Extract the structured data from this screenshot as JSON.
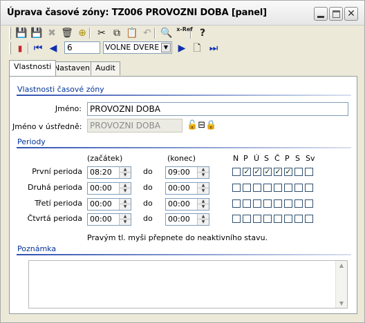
{
  "window": {
    "title": "Úprava časové zóny: TZ006 PROVOZNI DOBA [panel]",
    "minimize_label": "_",
    "close_label": "✕"
  },
  "toolbar": {
    "buttons": [
      {
        "icon": "save-icon",
        "glyph": "💾",
        "enabled": false
      },
      {
        "icon": "save-close-icon",
        "glyph": "💾",
        "enabled": true
      },
      {
        "icon": "delete-icon",
        "glyph": "✖",
        "enabled": false
      },
      {
        "icon": "trash-icon",
        "glyph": "🗑",
        "enabled": true
      },
      {
        "icon": "up-icon",
        "glyph": "⊕",
        "enabled": true
      },
      {
        "icon": "cut-icon",
        "glyph": "✂",
        "enabled": true
      },
      {
        "icon": "copy-icon",
        "glyph": "⧉",
        "enabled": true
      },
      {
        "icon": "paste-icon",
        "glyph": "📋",
        "enabled": false
      },
      {
        "icon": "undo-icon",
        "glyph": "↶",
        "enabled": false
      },
      {
        "icon": "binoculars-icon",
        "glyph": "🔍",
        "enabled": true
      },
      {
        "icon": "ref-icon",
        "glyph": "x-Ref",
        "enabled": true
      },
      {
        "icon": "help-icon",
        "glyph": "?",
        "enabled": true
      }
    ]
  },
  "navigator": {
    "first_glyph": "⏮",
    "prev_glyph": "◀",
    "next_glyph": "▶",
    "new_glyph": "🗋",
    "last_glyph": "⏭",
    "record_number": "6",
    "record_select": "VOLNE DVERE",
    "select_arrow": "▼"
  },
  "tabs": [
    {
      "label": "Vlastnosti",
      "active": true
    },
    {
      "label": "Nastavení",
      "active": false
    },
    {
      "label": "Audit",
      "active": false
    }
  ],
  "properties": {
    "section_title": "Vlastnosti časové zóny",
    "name_label": "Jméno:",
    "name_value": "PROVOZNI DOBA",
    "central_name_label": "Jméno v ústředně:",
    "central_name_value": "PROVOZNI DOBA"
  },
  "periods": {
    "section_title": "Periody",
    "start_header": "(začátek)",
    "end_header": "(konec)",
    "to_label": "do",
    "days": [
      "N",
      "P",
      "Ú",
      "S",
      "Č",
      "P",
      "S",
      "Sv"
    ],
    "rows": [
      {
        "label": "První perioda",
        "start": "08:20",
        "end": "09:00",
        "checked": [
          false,
          true,
          true,
          true,
          true,
          true,
          false,
          false
        ]
      },
      {
        "label": "Druhá perioda",
        "start": "00:00",
        "end": "00:00",
        "checked": [
          false,
          false,
          false,
          false,
          false,
          false,
          false,
          false
        ]
      },
      {
        "label": "Třetí perioda",
        "start": "00:00",
        "end": "00:00",
        "checked": [
          false,
          false,
          false,
          false,
          false,
          false,
          false,
          false
        ]
      },
      {
        "label": "Čtvrtá perioda",
        "start": "00:00",
        "end": "00:00",
        "checked": [
          false,
          false,
          false,
          false,
          false,
          false,
          false,
          false
        ]
      }
    ],
    "hint": "Pravým tl. myši přepnete do neaktivního stavu."
  },
  "note": {
    "section_title": "Poznámka",
    "value": ""
  }
}
